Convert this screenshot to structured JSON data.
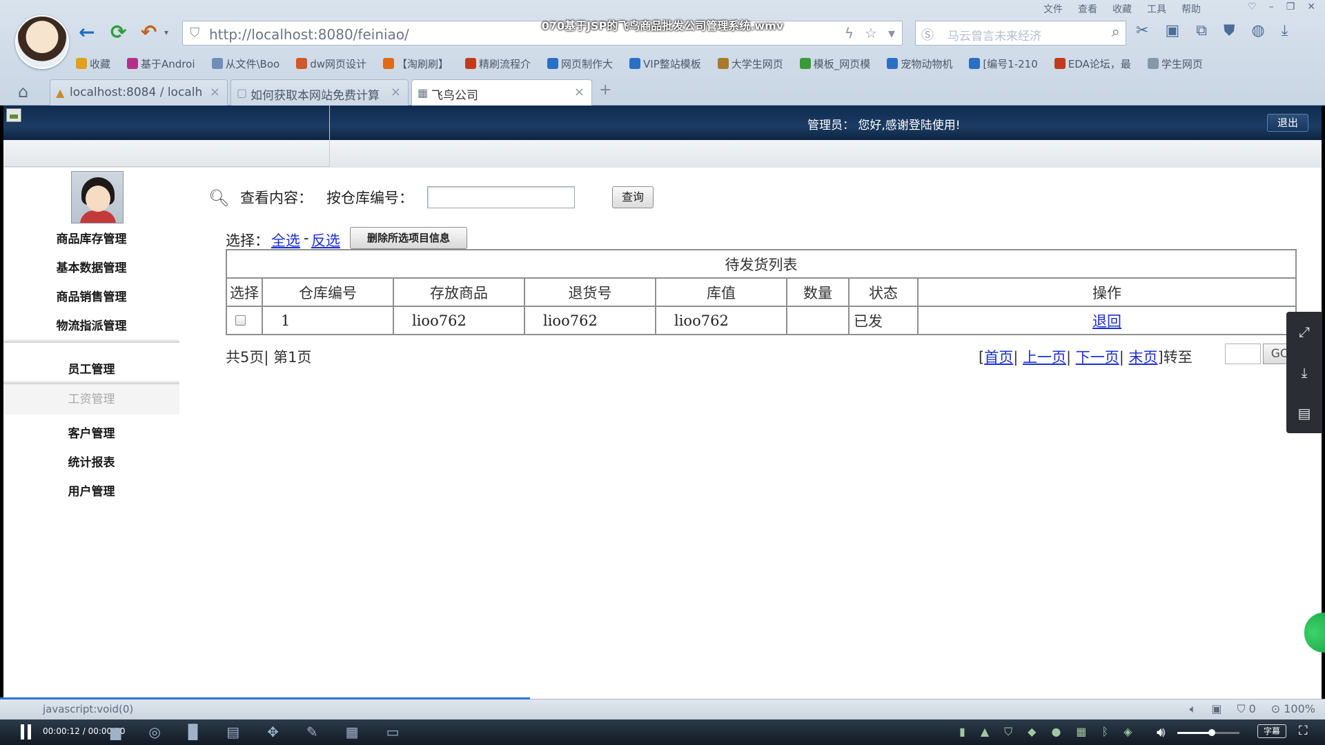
{
  "video": {
    "title": "070基于JSP的飞鸟商品批发公司管理系统.wmv",
    "time": "00:00:12 / 00:00:30",
    "progress_fraction": 0.4,
    "volume_fraction": 0.55,
    "subtitle_label": "字幕"
  },
  "browser": {
    "menu": [
      "文件",
      "查看",
      "收藏",
      "工具",
      "帮助"
    ],
    "address": "http://localhost:8080/feiniao/",
    "search_placeholder": "马云曾言未来经济",
    "bookmarks": [
      {
        "label": "收藏",
        "icon": "star-icon",
        "color": "#e0a020"
      },
      {
        "label": "基于Androi",
        "icon": "page-icon",
        "color": "#b3308a"
      },
      {
        "label": "从文件\\Boo",
        "icon": "folder-icon",
        "color": "#6f8fb8"
      },
      {
        "label": "dw网页设计",
        "icon": "dw-icon",
        "color": "#d0582a"
      },
      {
        "label": "【淘刷刷】",
        "icon": "taobao-icon",
        "color": "#e06a18"
      },
      {
        "label": "精刷流程介",
        "icon": "shield-icon",
        "color": "#c23a1a"
      },
      {
        "label": "网页制作大",
        "icon": "globe-icon",
        "color": "#2a6fc4"
      },
      {
        "label": "VIP整站模板",
        "icon": "vip-icon",
        "color": "#2a6fc4"
      },
      {
        "label": "大学生网页",
        "icon": "cube-icon",
        "color": "#a87a2a"
      },
      {
        "label": "模板_网页模",
        "icon": "template-icon",
        "color": "#3a9a3a"
      },
      {
        "label": "宠物动物机",
        "icon": "pet-icon",
        "color": "#2a6fc4"
      },
      {
        "label": "[编号1-210",
        "icon": "number-icon",
        "color": "#2a6fc4"
      },
      {
        "label": "EDA论坛，最",
        "icon": "eda-icon",
        "color": "#c23a1a"
      },
      {
        "label": "学生网页",
        "icon": "page-icon",
        "color": "#8796a8"
      }
    ],
    "tabs": [
      {
        "label": "localhost:8084 / localh",
        "active": false
      },
      {
        "label": "如何获取本网站免费计算",
        "active": false
      },
      {
        "label": "飞鸟公司",
        "active": true
      }
    ],
    "status_text": "javascript:void(0)",
    "status_zoom": "100%",
    "status_count": "0"
  },
  "app": {
    "greeting": "管理员：  您好,感谢登陆使用!",
    "logout_label": "退出",
    "sidebar": {
      "items": [
        {
          "label": "商品库存管理",
          "name": "sidebar-item-inventory"
        },
        {
          "label": "基本数据管理",
          "name": "sidebar-item-basic-data"
        },
        {
          "label": "商品销售管理",
          "name": "sidebar-item-sales"
        },
        {
          "label": "物流指派管理",
          "name": "sidebar-item-logistics"
        },
        {
          "label": "员工管理",
          "name": "sidebar-item-employees"
        },
        {
          "label": "工资管理",
          "name": "sidebar-item-salary"
        },
        {
          "label": "客户管理",
          "name": "sidebar-item-customers"
        },
        {
          "label": "统计报表",
          "name": "sidebar-item-reports"
        },
        {
          "label": "用户管理",
          "name": "sidebar-item-users"
        }
      ]
    },
    "search": {
      "view_label": "查看内容：",
      "filter_label": "按仓库编号：",
      "input_value": "",
      "query_button": "查询"
    },
    "selection": {
      "label": "选择：",
      "select_all": "全选",
      "separator": "-",
      "invert": "反选",
      "delete_button": "删除所选项目信息"
    },
    "table": {
      "caption": "待发货列表",
      "columns": [
        "选择",
        "仓库编号",
        "存放商品",
        "退货号",
        "库值",
        "数量",
        "状态",
        "操作"
      ],
      "rows": [
        {
          "checked": false,
          "warehouse_no": "1",
          "goods": "lioo762",
          "return_no": "lioo762",
          "stock_value": "lioo762",
          "quantity": "",
          "status": "已发",
          "action": "退回"
        }
      ]
    },
    "pagination": {
      "total_pages": "共5页",
      "current_page": "第1页",
      "first": "首页",
      "prev": "上一页",
      "next": "下一页",
      "last": "末页",
      "goto_label": "转至",
      "go_button": "GO"
    }
  }
}
